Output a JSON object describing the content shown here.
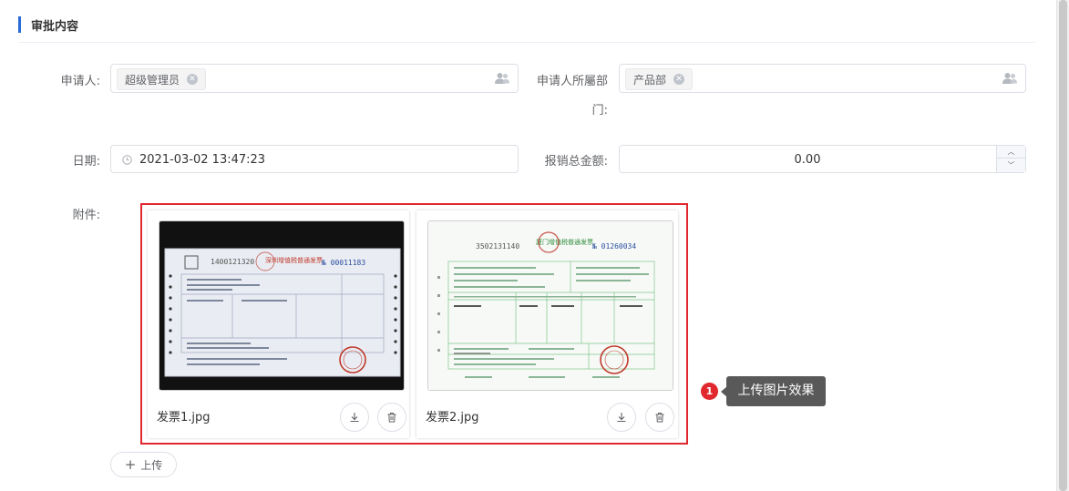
{
  "section": {
    "title": "审批内容"
  },
  "form": {
    "applicant": {
      "label": "申请人:",
      "tag": "超级管理员",
      "icon": "user-group-icon"
    },
    "department": {
      "label_line1": "申请人所屬部",
      "label_line2": "门:",
      "tag": "产品部",
      "icon": "user-group-icon"
    },
    "date": {
      "label": "日期:",
      "value": "2021-03-02 13:47:23",
      "icon": "clock-icon"
    },
    "amount": {
      "label": "报销总金额:",
      "value": "0.00"
    },
    "attachments": {
      "label": "附件:",
      "files": [
        {
          "name": "发票1.jpg",
          "invoice_number": "1400121320",
          "invoice_no": "№ 00011183"
        },
        {
          "name": "发票2.jpg",
          "invoice_number": "3502131140",
          "invoice_no": "№ 01260034"
        }
      ]
    }
  },
  "callout": {
    "number": "1",
    "text": "上传图片效果"
  },
  "upload": {
    "label": "上传"
  },
  "colors": {
    "accent": "#2a6cd8",
    "highlight": "#e0282e",
    "tooltip": "#595959"
  }
}
